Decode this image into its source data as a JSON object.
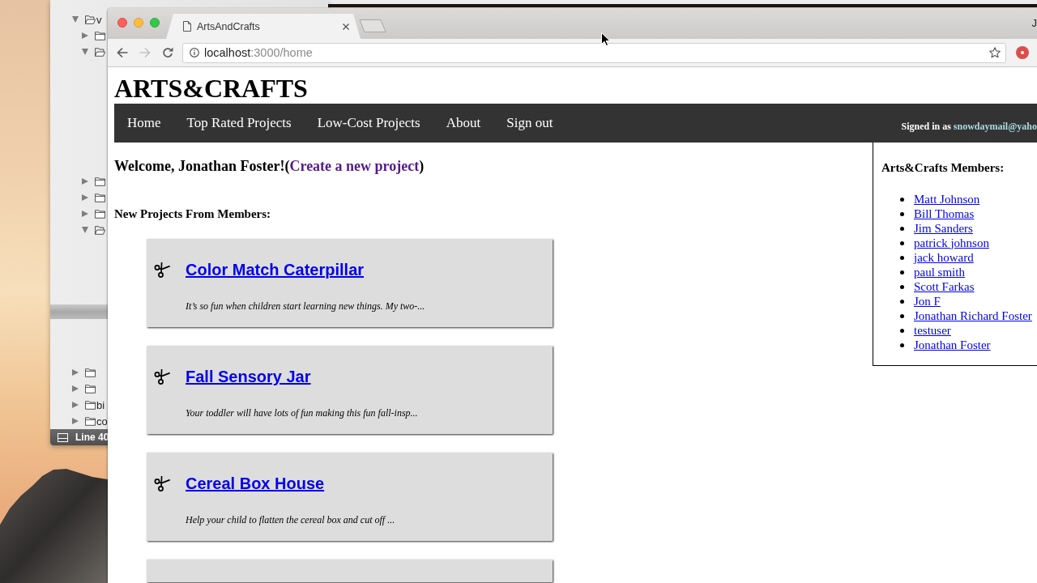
{
  "desktop": {
    "editor": {
      "panes": [
        {
          "tree": [
            {
              "name": "v",
              "expanded": true,
              "children": [
                {
                  "expanded": false
                },
                {
                  "expanded": true
                },
                {
                  "expanded": false
                },
                {
                  "expanded": false
                },
                {
                  "expanded": false
                },
                {
                  "expanded": true
                }
              ]
            }
          ]
        },
        {
          "tree": [
            {
              "expanded": false
            },
            {
              "expanded": false
            },
            {
              "name": "bi",
              "expanded": false
            },
            {
              "name": "co",
              "expanded": false
            }
          ]
        }
      ],
      "status": "Line 40"
    }
  },
  "browser": {
    "tabs": [
      {
        "title": "ArtsAndCrafts",
        "selected": true
      }
    ],
    "profile": "J",
    "nav_buttons": [
      {
        "kind": "back",
        "disabled": false
      },
      {
        "kind": "forward",
        "disabled": true
      },
      {
        "kind": "reload",
        "disabled": false
      }
    ],
    "address": {
      "host": "localhost",
      "path": ":3000/home"
    }
  },
  "page": {
    "site_title": "ARTS&CRAFTS",
    "nav": [
      "Home",
      "Top Rated Projects",
      "Low-Cost Projects",
      "About",
      "Sign out"
    ],
    "signed_in": {
      "text": "Signed in as",
      "email": "snowdaymail@yaho"
    },
    "welcome": {
      "before": "Welcome, Jonathan Foster!(",
      "link": "Create a new project",
      "visited": true,
      "after": ")"
    },
    "section_title": "New Projects From Members:",
    "projects": [
      {
        "kind": "full",
        "title": "Color Match Caterpillar",
        "summary": "It’s so fun when children start learning new things. My two-..."
      },
      {
        "kind": "full",
        "title": "Fall Sensory Jar",
        "summary": "Your toddler will have lots of fun making this fun fall-insp..."
      },
      {
        "kind": "full",
        "title": "Cereal Box House",
        "summary": "Help your child to flatten the cereal box and cut off ..."
      },
      {
        "kind": "cut_off"
      }
    ],
    "members": {
      "title": "Arts&Crafts Members:",
      "items": [
        "Matt Johnson",
        "Bill Thomas",
        "Jim Sanders",
        "patrick johnson",
        "jack howard",
        "paul smith",
        "Scott Farkas",
        "Jon F",
        "Jonathan Richard Foster",
        "testuser",
        "Jonathan Foster"
      ]
    }
  }
}
